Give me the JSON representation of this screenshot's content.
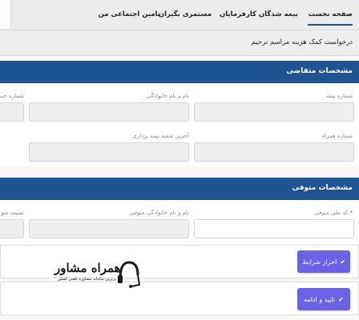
{
  "nav": {
    "items": [
      {
        "label": "صفحه نخست"
      },
      {
        "label": "بیمه شدگان"
      },
      {
        "label": "کارفرمایان"
      },
      {
        "label": "مستمری بگیران"
      },
      {
        "label": "تامین اجتماعی من"
      }
    ]
  },
  "page": {
    "title": "درخواست کمک هزینه مراسم ترحیم"
  },
  "claimant_section": {
    "title": "مشخصات متقاضی",
    "fields": [
      {
        "label": "شماره بیمه"
      },
      {
        "label": "نام و نام خانوادگی"
      },
      {
        "label": "شماره حس"
      },
      {
        "label": "شماره همراه"
      },
      {
        "label": "آخرین شعبه بیمه پردازی"
      }
    ]
  },
  "deceased_section": {
    "title": "مشخصات متوفی",
    "fields": [
      {
        "label": "کد ملی متوفی",
        "required": "*"
      },
      {
        "label": "نام و نام خانوادگی متوفی"
      },
      {
        "label": "نسبت متو"
      }
    ]
  },
  "actions": {
    "verify_label": "احراز شرایط",
    "confirm_label": "تایید و ادامه"
  },
  "watermark": {
    "brand": "همراه مشاور",
    "tagline": "برترین سامانه مشاوره تلفنی کشور"
  },
  "colors": {
    "header_blue": "#1f5493",
    "button_purple": "#6a63e6"
  }
}
